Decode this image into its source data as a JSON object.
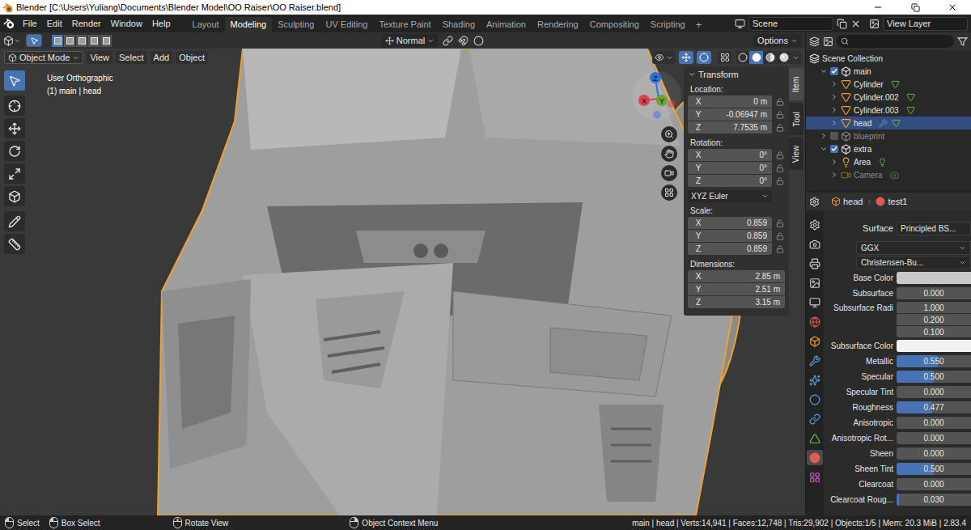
{
  "window": {
    "title": "Blender [C:\\Users\\Yuliang\\Documents\\Blender Model\\OO Raiser\\OO Raiser.blend]"
  },
  "menus": [
    "File",
    "Edit",
    "Render",
    "Window",
    "Help"
  ],
  "workspaces": [
    {
      "label": "Layout",
      "selected": false
    },
    {
      "label": "Modeling",
      "selected": true
    },
    {
      "label": "Sculpting",
      "selected": false
    },
    {
      "label": "UV Editing",
      "selected": false
    },
    {
      "label": "Texture Paint",
      "selected": false
    },
    {
      "label": "Shading",
      "selected": false
    },
    {
      "label": "Animation",
      "selected": false
    },
    {
      "label": "Rendering",
      "selected": false
    },
    {
      "label": "Compositing",
      "selected": false
    },
    {
      "label": "Scripting",
      "selected": false
    }
  ],
  "workspace_add": "+",
  "scene": "Scene",
  "view_layer": "View Layer",
  "viewport": {
    "select_modes": [
      {
        "selected": true
      },
      {
        "selected": false
      },
      {
        "selected": false
      },
      {
        "selected": false
      },
      {
        "selected": false
      }
    ],
    "orientation": "Normal",
    "options": "Options",
    "mode": "Object Mode",
    "menus": [
      "View",
      "Select",
      "Add",
      "Object"
    ],
    "gizmos_on": true,
    "overlays_on": true,
    "xray_on": false,
    "shading": [
      {
        "kind": "wireframe",
        "selected": false
      },
      {
        "kind": "solid",
        "selected": true
      },
      {
        "kind": "material",
        "selected": false
      },
      {
        "kind": "rendered",
        "selected": false
      }
    ],
    "view_name": "User Orthographic",
    "context": "(1) main | head",
    "axes": [
      {
        "label": "Z",
        "color": "#2f6fdc"
      },
      {
        "label": "Y",
        "color": "#6aa530"
      },
      {
        "label": "X",
        "color": "#e1414f"
      }
    ],
    "tools": [
      {
        "kind": "select",
        "selected": true
      },
      {
        "kind": "cursor",
        "selected": false
      },
      {
        "kind": "move",
        "selected": false
      },
      {
        "kind": "rotate",
        "selected": false
      },
      {
        "kind": "scale",
        "selected": false
      },
      {
        "kind": "transform",
        "selected": false
      },
      {
        "kind": "annotate",
        "selected": false
      },
      {
        "kind": "measure",
        "selected": false
      }
    ]
  },
  "sidebar": {
    "tabs": [
      {
        "label": "Item",
        "selected": true
      },
      {
        "label": "Tool",
        "selected": false
      },
      {
        "label": "View",
        "selected": false
      }
    ],
    "panel": "Transform",
    "groups": [
      {
        "label": "Location:",
        "lockable": true,
        "fields": [
          {
            "axis": "X",
            "value": "0 m",
            "locked": false
          },
          {
            "axis": "Y",
            "value": "-0.06947 m",
            "locked": false
          },
          {
            "axis": "Z",
            "value": "7.7535 m",
            "locked": false
          }
        ]
      },
      {
        "label": "Rotation:",
        "lockable": true,
        "mode": "XYZ Euler",
        "fields": [
          {
            "axis": "X",
            "value": "0°",
            "locked": false
          },
          {
            "axis": "Y",
            "value": "0°",
            "locked": false
          },
          {
            "axis": "Z",
            "value": "0°",
            "locked": false
          }
        ]
      },
      {
        "label": "Scale:",
        "lockable": true,
        "fields": [
          {
            "axis": "X",
            "value": "0.859",
            "locked": false
          },
          {
            "axis": "Y",
            "value": "0.859",
            "locked": false
          },
          {
            "axis": "Z",
            "value": "0.859",
            "locked": false
          }
        ]
      },
      {
        "label": "Dimensions:",
        "lockable": false,
        "fields": [
          {
            "axis": "X",
            "value": "2.85 m",
            "locked": false
          },
          {
            "axis": "Y",
            "value": "2.51 m",
            "locked": false
          },
          {
            "axis": "Z",
            "value": "3.15 m",
            "locked": false
          }
        ]
      }
    ]
  },
  "outliner": {
    "items": [
      {
        "label": "Scene Collection",
        "kind": "scene_collection",
        "depth": 0,
        "selected": false,
        "disabled": false
      },
      {
        "label": "main",
        "kind": "collection",
        "depth": 1,
        "expanded": true,
        "checked": true,
        "selected": false,
        "disabled": false
      },
      {
        "label": "Cylinder",
        "kind": "mesh",
        "depth": 2,
        "expanded": false,
        "selected": false,
        "disabled": false,
        "has_modifiers": false
      },
      {
        "label": "Cylinder.002",
        "kind": "mesh",
        "depth": 2,
        "expanded": false,
        "selected": false,
        "disabled": false,
        "has_modifiers": false
      },
      {
        "label": "Cylinder.003",
        "kind": "mesh",
        "depth": 2,
        "expanded": false,
        "selected": false,
        "disabled": false,
        "has_modifiers": false
      },
      {
        "label": "head",
        "kind": "mesh",
        "depth": 2,
        "expanded": false,
        "selected": true,
        "disabled": false,
        "has_modifiers": true
      },
      {
        "label": "blueprint",
        "kind": "collection",
        "depth": 1,
        "expanded": false,
        "checked": false,
        "selected": false,
        "disabled": true
      },
      {
        "label": "extra",
        "kind": "collection",
        "depth": 1,
        "expanded": true,
        "checked": true,
        "selected": false,
        "disabled": false
      },
      {
        "label": "Area",
        "kind": "light",
        "depth": 2,
        "expanded": false,
        "selected": false,
        "disabled": false,
        "has_modifiers": false
      },
      {
        "label": "Camera",
        "kind": "camera",
        "depth": 2,
        "expanded": false,
        "selected": false,
        "disabled": true,
        "has_modifiers": false
      }
    ]
  },
  "properties": {
    "breadcrumb": [
      {
        "label": "head",
        "kind": "object"
      },
      {
        "label": "test1",
        "kind": "material"
      }
    ],
    "tabs": [
      {
        "kind": "tool",
        "selected": false,
        "color": "#cccccc"
      },
      {
        "kind": "render",
        "selected": false,
        "color": "#cccccc"
      },
      {
        "kind": "output",
        "selected": false,
        "color": "#cccccc"
      },
      {
        "kind": "view_layer",
        "selected": false,
        "color": "#cccccc"
      },
      {
        "kind": "scene",
        "selected": false,
        "color": "#cccccc"
      },
      {
        "kind": "world",
        "selected": false,
        "color": "#d9534f"
      },
      {
        "kind": "object",
        "selected": false,
        "color": "#f0a030"
      },
      {
        "kind": "modifiers",
        "selected": false,
        "color": "#5b9bd5"
      },
      {
        "kind": "particles",
        "selected": false,
        "color": "#5b9bd5"
      },
      {
        "kind": "physics",
        "selected": false,
        "color": "#5b9bd5"
      },
      {
        "kind": "constraints",
        "selected": false,
        "color": "#5b9bd5"
      },
      {
        "kind": "data",
        "selected": false,
        "color": "#6fbf4a"
      },
      {
        "kind": "material",
        "selected": true,
        "color": "#e05a5a"
      },
      {
        "kind": "texture",
        "selected": false,
        "color": "#d05ad0"
      }
    ],
    "rows": [
      {
        "kind": "header",
        "label": "Surface",
        "value": "Principled BS..."
      },
      {
        "kind": "dropdown",
        "value": "GGX"
      },
      {
        "kind": "dropdown",
        "value": "Christensen-Bu..."
      },
      {
        "kind": "color",
        "label": "Base Color",
        "color": "#c8c8c8"
      },
      {
        "kind": "slider",
        "label": "Subsurface",
        "value": "0.000",
        "level": 0
      },
      {
        "kind": "vector",
        "label": "Subsurface Radi",
        "values": [
          "1.000",
          "0.200",
          "0.100"
        ]
      },
      {
        "kind": "color",
        "label": "Subsurface Color",
        "color": "#f2f2f2"
      },
      {
        "kind": "slider",
        "label": "Metallic",
        "value": "0.550",
        "level": 0.55
      },
      {
        "kind": "slider",
        "label": "Specular",
        "value": "0.500",
        "level": 0.5
      },
      {
        "kind": "slider",
        "label": "Specular Tint",
        "value": "0.000",
        "level": 0
      },
      {
        "kind": "slider",
        "label": "Roughness",
        "value": "0.477",
        "level": 0.477
      },
      {
        "kind": "slider",
        "label": "Anisotropic",
        "value": "0.000",
        "level": 0
      },
      {
        "kind": "slider",
        "label": "Anisotropic Rot...",
        "value": "0.000",
        "level": 0
      },
      {
        "kind": "slider",
        "label": "Sheen",
        "value": "0.000",
        "level": 0
      },
      {
        "kind": "slider",
        "label": "Sheen Tint",
        "value": "0.500",
        "level": 0.5
      },
      {
        "kind": "slider",
        "label": "Clearcoat",
        "value": "0.000",
        "level": 0
      },
      {
        "kind": "slider",
        "label": "Clearcoat Roug...",
        "value": "0.030",
        "level": 0.03
      }
    ]
  },
  "status_bar": {
    "hints": [
      {
        "label": "Select",
        "kind": "left"
      },
      {
        "label": "Box Select",
        "kind": "drag"
      },
      {
        "label": "Rotate View",
        "kind": "middle"
      },
      {
        "label": "Object Context Menu",
        "kind": "right"
      }
    ],
    "stats": "main | head | Verts:14,941 | Faces:12,748 | Tris:29,902 | Objects:1/5 | Mem: 20.3 MiB | 2.83.4"
  }
}
